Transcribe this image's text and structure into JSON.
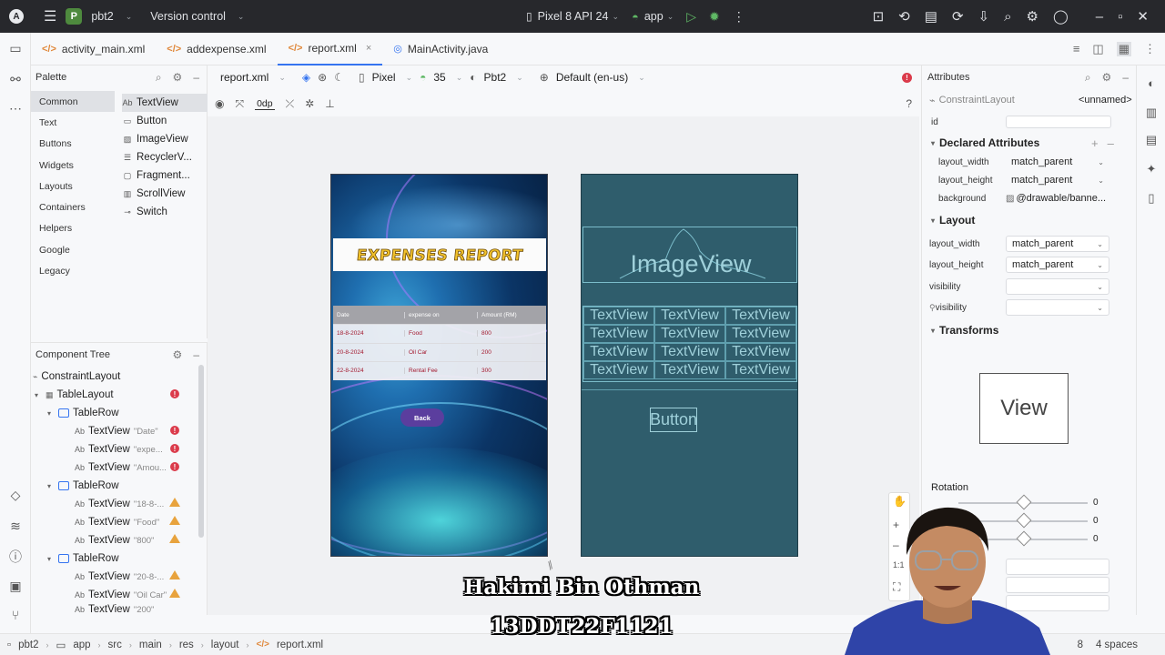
{
  "titlebar": {
    "project_badge": "P",
    "project_name": "pbt2",
    "vcs": "Version control",
    "device": "Pixel 8 API 24",
    "run_config": "app"
  },
  "tabs": [
    {
      "label": "activity_main.xml"
    },
    {
      "label": "addexpense.xml"
    },
    {
      "label": "report.xml",
      "close": "×"
    },
    {
      "label": "MainActivity.java"
    }
  ],
  "palette": {
    "title": "Palette",
    "categories": [
      "Common",
      "Text",
      "Buttons",
      "Widgets",
      "Layouts",
      "Containers",
      "Helpers",
      "Google",
      "Legacy"
    ],
    "items": [
      "TextView",
      "Button",
      "ImageView",
      "RecyclerV...",
      "Fragment...",
      "ScrollView",
      "Switch"
    ],
    "textview_icon_text": "Ab"
  },
  "component_tree": {
    "title": "Component Tree",
    "nodes": [
      {
        "label": "ConstraintLayout",
        "hint": ""
      },
      {
        "label": "TableLayout",
        "hint": ""
      },
      {
        "label": "TableRow",
        "hint": ""
      },
      {
        "label": "TextView",
        "hint": "\"Date\""
      },
      {
        "label": "TextView",
        "hint": "\"expe..."
      },
      {
        "label": "TextView",
        "hint": "\"Amou..."
      },
      {
        "label": "TableRow",
        "hint": ""
      },
      {
        "label": "TextView",
        "hint": "\"18-8-..."
      },
      {
        "label": "TextView",
        "hint": "\"Food\""
      },
      {
        "label": "TextView",
        "hint": "\"800\""
      },
      {
        "label": "TableRow",
        "hint": ""
      },
      {
        "label": "TextView",
        "hint": "\"20-8-..."
      },
      {
        "label": "TextView",
        "hint": "\"Oil Car\""
      },
      {
        "label": "TextView",
        "hint": "\"200\""
      }
    ],
    "ab": "Ab",
    "error_mark": "!"
  },
  "design_toolbar": {
    "file": "report.xml",
    "device": "Pixel",
    "api": "35",
    "theme": "Pbt2",
    "locale": "Default (en-us)",
    "margin": "0dp"
  },
  "preview": {
    "banner": "EXPENSES REPORT",
    "headers": [
      "Date",
      "expense on",
      "Amount (RM)"
    ],
    "rows": [
      [
        "18-8-2024",
        "Food",
        "800"
      ],
      [
        "20-8-2024",
        "Oil Car",
        "200"
      ],
      [
        "22-8-2024",
        "Rental Fee",
        "300"
      ]
    ],
    "back_button": "Back"
  },
  "blueprint": {
    "image_label": "ImageView",
    "cell_label": "TextView",
    "button_label": "Button"
  },
  "attributes": {
    "title": "Attributes",
    "component": "ConstraintLayout",
    "name": "<unnamed>",
    "id_label": "id",
    "declared_title": "Declared Attributes",
    "declared": [
      {
        "label": "layout_width",
        "value": "match_parent"
      },
      {
        "label": "layout_height",
        "value": "match_parent"
      },
      {
        "label": "background",
        "value": "@drawable/banne..."
      }
    ],
    "layout_title": "Layout",
    "layout": [
      {
        "label": "layout_width",
        "value": "match_parent"
      },
      {
        "label": "layout_height",
        "value": "match_parent"
      },
      {
        "label": "visibility",
        "value": ""
      },
      {
        "label": "visibility",
        "value": ""
      }
    ],
    "transforms_title": "Transforms",
    "view_label": "View",
    "rotation_label": "Rotation",
    "rotation_values": [
      "0",
      "0",
      "0"
    ]
  },
  "breadcrumb": [
    "pbt2",
    "app",
    "src",
    "main",
    "res",
    "layout",
    "report.xml"
  ],
  "status_right": [
    "8",
    "4 spaces"
  ],
  "caption": {
    "name": "Hakimi Bin Othman",
    "id": "13DDT22F1121"
  },
  "colors": {
    "accent": "#3574f0",
    "error": "#db3b4b",
    "warning": "#e8a33d",
    "blueprint": "#2f5d6c"
  }
}
